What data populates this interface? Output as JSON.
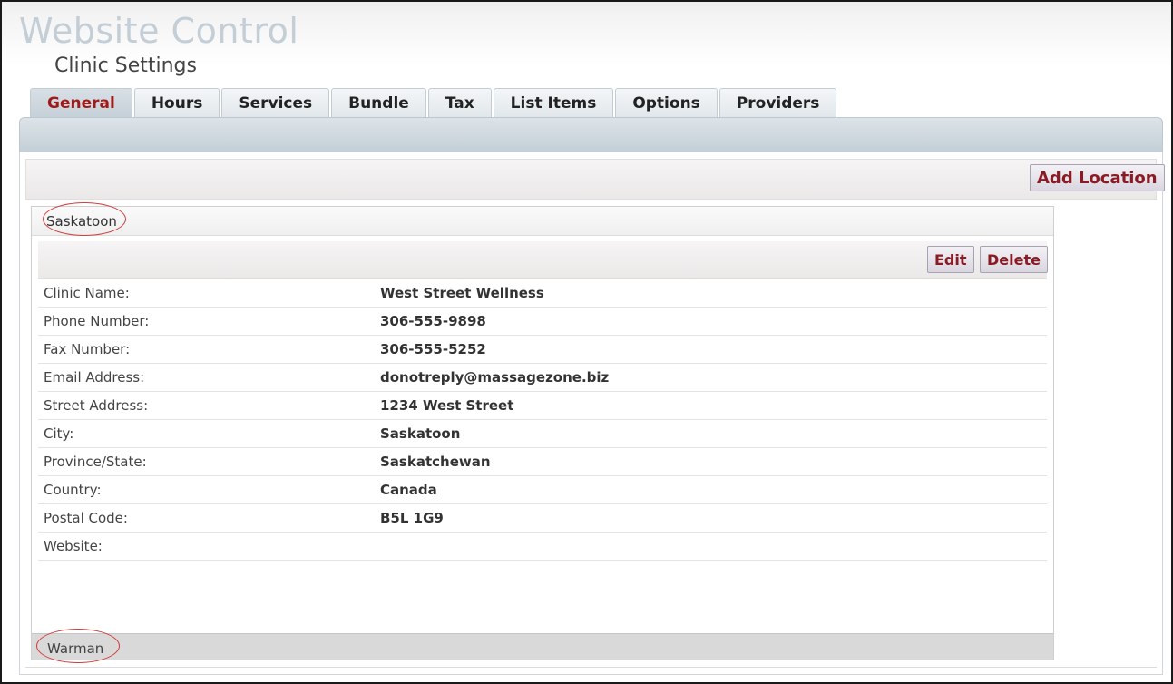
{
  "app_title": "Website Control",
  "page_subtitle": "Clinic Settings",
  "tabs": [
    {
      "label": "General",
      "active": true
    },
    {
      "label": "Hours",
      "active": false
    },
    {
      "label": "Services",
      "active": false
    },
    {
      "label": "Bundle",
      "active": false
    },
    {
      "label": "Tax",
      "active": false
    },
    {
      "label": "List Items",
      "active": false
    },
    {
      "label": "Options",
      "active": false
    },
    {
      "label": "Providers",
      "active": false
    }
  ],
  "toolbar": {
    "add_location_label": "Add Location"
  },
  "location": {
    "name": "Saskatoon",
    "edit_label": "Edit",
    "delete_label": "Delete",
    "fields": [
      {
        "label": "Clinic Name:",
        "value": "West Street Wellness"
      },
      {
        "label": "Phone Number:",
        "value": "306-555-9898"
      },
      {
        "label": "Fax Number:",
        "value": "306-555-5252"
      },
      {
        "label": "Email Address:",
        "value": "donotreply@massagezone.biz"
      },
      {
        "label": "Street Address:",
        "value": "1234 West Street"
      },
      {
        "label": "City:",
        "value": "Saskatoon"
      },
      {
        "label": "Province/State:",
        "value": "Saskatchewan"
      },
      {
        "label": "Country:",
        "value": "Canada"
      },
      {
        "label": "Postal Code:",
        "value": "B5L 1G9"
      },
      {
        "label": "Website:",
        "value": ""
      }
    ]
  },
  "second_location": {
    "name": "Warman"
  },
  "colors": {
    "accent": "#a01a1a",
    "button_text": "#8a1a24",
    "annotation_ring": "#d23a3a"
  }
}
